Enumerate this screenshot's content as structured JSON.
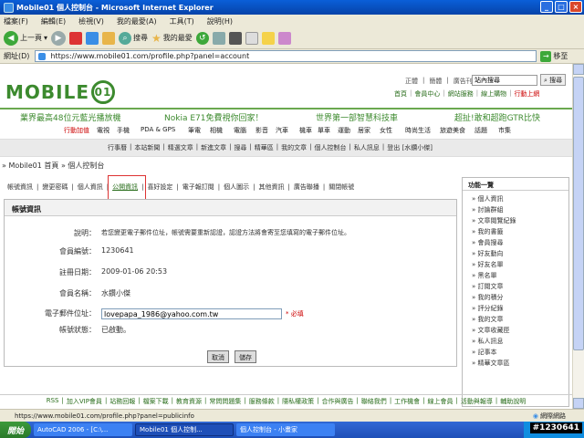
{
  "window": {
    "title": "Mobile01 個人控制台 - Microsoft Internet Explorer"
  },
  "menu": [
    "檔案(F)",
    "編輯(E)",
    "檢視(V)",
    "我的最愛(A)",
    "工具(T)",
    "說明(H)"
  ],
  "toolbar": {
    "back": "上一頁",
    "search": "搜尋",
    "favorites": "我的最愛"
  },
  "address": {
    "label": "網址(D)",
    "url": "https://www.mobile01.com/profile.php?panel=account",
    "go": "移至"
  },
  "site": {
    "logo": "MOBILE",
    "toplinks": [
      "正體",
      "簡體",
      "廣告刊登"
    ],
    "search_value": "站內搜尋",
    "search_button": "搜尋",
    "subnav": [
      "首頁",
      "會員中心",
      "網站服務",
      "線上購物",
      "行動上網"
    ],
    "ads": [
      "業界最高48位元藍光播放機",
      "Nokia E71免費視你回家！",
      "世界第一部智慧科技車",
      "超扯!敢和超跑GTR比快"
    ],
    "nav": [
      "行動加值",
      "電視",
      "手機",
      "PDA & GPS",
      "筆電",
      "相機",
      "電腦",
      "影音",
      "汽車",
      "機車",
      "單車",
      "運動",
      "居家",
      "女性",
      "時尚生活",
      "旅遊美食",
      "話題",
      "市集"
    ],
    "graybar": [
      "行事曆",
      "本站新聞",
      "精選文章",
      "新進文章",
      "搜尋",
      "精華區",
      "我的文章",
      "個人控制台",
      "私人訊息",
      "登出 [水鑽小傑]"
    ],
    "breadcrumb": "» Mobile01 首頁 » 個人控制台"
  },
  "tabs": [
    "帳號資訊",
    "變更密碼",
    "個人資訊",
    "公開資訊",
    "喜好設定",
    "電子報訂閱",
    "個人圖示",
    "其他資訊",
    "廣告聯播",
    "關閉帳號"
  ],
  "annotation": {
    "text": "點選"
  },
  "panel": {
    "heading": "帳號資訊",
    "desc_label": "說明：",
    "desc": "若您變更電子郵件位址，帳號需要重新認證，認證方法將會寄至您填寫的電子郵件位址。",
    "member_id_label": "會員編號：",
    "member_id": "1230641",
    "reg_date_label": "註冊日期：",
    "reg_date": "2009-01-06 20:53",
    "member_name_label": "會員名稱：",
    "member_name": "水鑽小傑",
    "email_label": "電子郵件位址：",
    "email": "lovepapa_1986@yahoo.com.tw",
    "required": "* 必填",
    "status_label": "帳號狀態：",
    "status": "已啟動。",
    "cancel": "取消",
    "save": "儲存"
  },
  "sidebar": {
    "heading": "功能一覽",
    "items": [
      "» 個人資訊",
      "» 討論群組",
      "» 文章閱覽紀錄",
      "» 我的書籤",
      "» 會員搜尋",
      "» 好友動向",
      "» 好友名單",
      "» 黑名單",
      "» 訂閱文章",
      "» 我的積分",
      "» 評分紀錄",
      "» 我的文章",
      "» 文章收藏匣",
      "» 私人訊息",
      "» 記事本",
      "» 精華文章區"
    ]
  },
  "footer": [
    "RSS",
    "加入VIP會員",
    "站務回報",
    "檔案下載",
    "教育資源",
    "常問問題集",
    "服務條款",
    "隱私權政策",
    "合作與廣告",
    "聯絡我們",
    "工作機會",
    "線上會員",
    "活動與報導",
    "輔助說明"
  ],
  "statusbar": {
    "url": "https://www.mobile01.com/profile.php?panel=publicinfo",
    "zone": "網際網路"
  },
  "taskbar": {
    "start": "開始",
    "tasks": [
      "AutoCAD 2006 - [C:\\...",
      "Mobile01 個人控制...",
      "個人控制台 - 小畫家"
    ],
    "watermark": "#1230641"
  }
}
